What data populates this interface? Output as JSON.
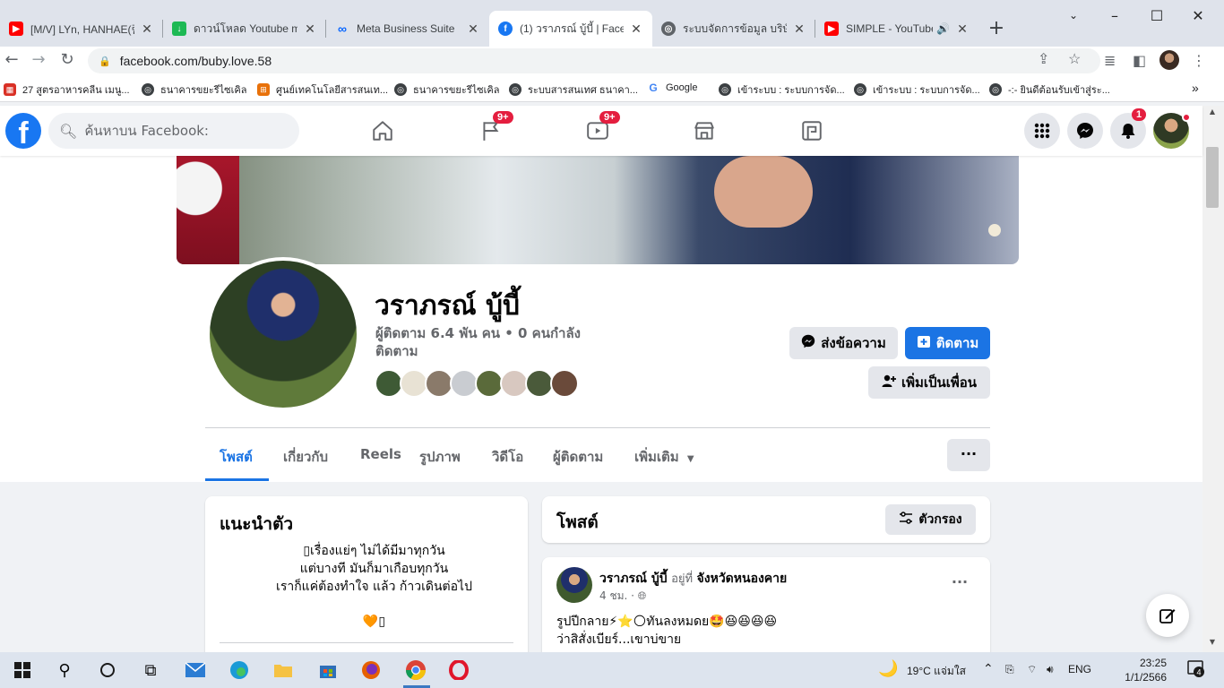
{
  "browser": {
    "tabs": [
      {
        "title": "[M/V] LYn, HANHAE(린",
        "icon": "youtube-icon",
        "color": "#ff0000"
      },
      {
        "title": "ดาวน์โหลด Youtube mp",
        "icon": "download-icon",
        "color": "#1db954"
      },
      {
        "title": "Meta Business Suite",
        "icon": "meta-icon",
        "color": "#0866ff"
      },
      {
        "title": "(1) วราภรณ์ บู้บี้ | Faceb",
        "icon": "facebook-icon",
        "color": "#1877f2",
        "active": true
      },
      {
        "title": "ระบบจัดการข้อมูล บริษัท",
        "icon": "globe-icon",
        "color": "#5f6368"
      },
      {
        "title": "SIMPLE - YouTube",
        "icon": "youtube-icon",
        "color": "#ff0000",
        "audio": true
      }
    ],
    "url": "facebook.com/buby.love.58",
    "bookmarks": [
      {
        "label": "27 สูตรอาหารคลีน เมนู...",
        "icon": "bookmark-icon",
        "color": "#d93025"
      },
      {
        "label": "ธนาคารขยะรีไซเคิล",
        "icon": "globe-icon",
        "color": "#3c4043"
      },
      {
        "label": "ศูนย์เทคโนโลยีสารสนเท...",
        "icon": "bookmark-icon",
        "color": "#e8710a"
      },
      {
        "label": "ธนาคารขยะรีไซเคิล",
        "icon": "globe-icon",
        "color": "#3c4043"
      },
      {
        "label": "ระบบสารสนเทศ ธนาคา...",
        "icon": "globe-icon",
        "color": "#3c4043"
      },
      {
        "label": "Google",
        "icon": "google-icon",
        "color": "#4285f4"
      },
      {
        "label": "เข้าระบบ : ระบบการจัด...",
        "icon": "globe-icon",
        "color": "#3c4043"
      },
      {
        "label": "เข้าระบบ : ระบบการจัด...",
        "icon": "globe-icon",
        "color": "#3c4043"
      },
      {
        "label": "-:- ยินดีต้อนรับเข้าสู่ระ...",
        "icon": "globe-icon",
        "color": "#3c4043"
      }
    ],
    "more_bookmarks": "»"
  },
  "facebook": {
    "logo": "f",
    "search_placeholder": "ค้นหาบน Facebook:",
    "nav_badges": {
      "flag": "9+",
      "watch": "9+",
      "notifications": "1"
    },
    "brand_color": "#1877f2"
  },
  "profile": {
    "name": "วราภรณ์ บู้บี้",
    "stats": "ผู้ติดตาม 6.4 พัน คน • 0 คนกำลังติดตาม",
    "buttons": {
      "message": "ส่งข้อความ",
      "follow": "ติดตาม",
      "add_friend": "เพิ่มเป็นเพื่อน"
    },
    "tabs": [
      "โพสต์",
      "เกี่ยวกับ",
      "Reels",
      "รูปภาพ",
      "วิดีโอ",
      "ผู้ติดตาม",
      "เพิ่มเติม"
    ],
    "more_options": "···"
  },
  "intro": {
    "title": "แนะนำตัว",
    "bio_lines": [
      "▯เรื่องแย่ๆ ไม่ได้มีมาทุกวัน",
      "แต่บางที มันก็มาเกือบทุกวัน",
      "เราก็แค่ต้องทำใจ แล้ว ก้าวเดินต่อไป"
    ],
    "emoji_line": "🧡▯"
  },
  "posts": {
    "title": "โพสต์",
    "filter_label": "ตัวกรอง",
    "first_post": {
      "author": "วราภรณ์ บู้บี้",
      "location_prefix": "อยู่ที่",
      "location": "จังหวัดหนองคาย",
      "time": "4 ชม. ·",
      "text_line1": "รูปปีกลาย⚡⭐🌕ทันลงหมดย🤩😆😆😆😆",
      "text_line2": "ว่าสิสั่งเบียร์...เขาบ่ขาย"
    }
  },
  "taskbar": {
    "weather": "19°C  แจ่มใส",
    "language": "ENG",
    "time": "23:25",
    "date": "1/1/2566",
    "notification_count": "4"
  }
}
